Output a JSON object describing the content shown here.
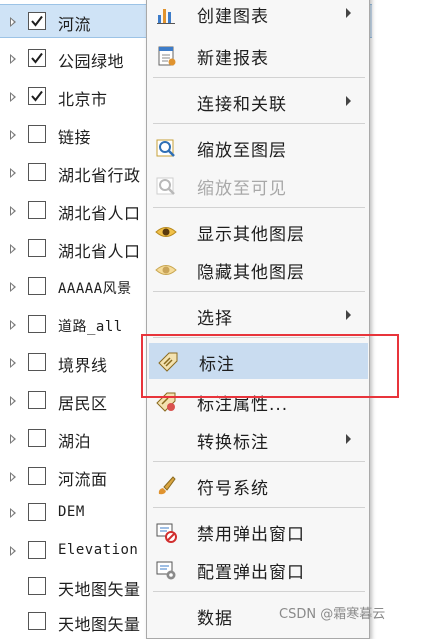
{
  "layers": [
    {
      "name": "河流",
      "checked": true,
      "selected": true,
      "expandable": true
    },
    {
      "name": "公园绿地",
      "checked": true,
      "selected": false,
      "expandable": true
    },
    {
      "name": "北京市",
      "checked": true,
      "selected": false,
      "expandable": true
    },
    {
      "name": "链接",
      "checked": false,
      "selected": false,
      "expandable": true
    },
    {
      "name": "湖北省行政",
      "checked": false,
      "selected": false,
      "expandable": true
    },
    {
      "name": "湖北省人口",
      "checked": false,
      "selected": false,
      "expandable": true
    },
    {
      "name": "湖北省人口",
      "checked": false,
      "selected": false,
      "expandable": true
    },
    {
      "name": "AAAAA风景",
      "checked": false,
      "selected": false,
      "expandable": true
    },
    {
      "name": "道路_all",
      "checked": false,
      "selected": false,
      "expandable": true
    },
    {
      "name": "境界线",
      "checked": false,
      "selected": false,
      "expandable": true
    },
    {
      "name": "居民区",
      "checked": false,
      "selected": false,
      "expandable": true
    },
    {
      "name": "湖泊",
      "checked": false,
      "selected": false,
      "expandable": true
    },
    {
      "name": "河流面",
      "checked": false,
      "selected": false,
      "expandable": true
    },
    {
      "name": "DEM",
      "checked": false,
      "selected": false,
      "expandable": true
    },
    {
      "name": "Elevation",
      "checked": false,
      "selected": false,
      "expandable": true
    },
    {
      "name": "天地图矢量",
      "checked": false,
      "selected": false,
      "expandable": false
    },
    {
      "name": "天地图矢量",
      "checked": false,
      "selected": false,
      "expandable": false
    }
  ],
  "menu": {
    "create_chart": "创建图表",
    "new_report": "新建报表",
    "joins_relates": "连接和关联",
    "zoom_to_layer": "缩放至图层",
    "zoom_to_visible": "缩放至可见",
    "show_other_layers": "显示其他图层",
    "hide_other_layers": "隐藏其他图层",
    "selection": "选择",
    "label": "标注",
    "label_properties": "标注属性...",
    "convert_labels": "转换标注",
    "symbology": "符号系统",
    "disable_popups": "禁用弹出窗口",
    "configure_popups": "配置弹出窗口",
    "data": "数据"
  },
  "colors": {
    "selection": "#cfe3f6",
    "highlight": "#c9dcf0",
    "annotation": "#e8343b"
  },
  "watermark": "CSDN @霜寒暮云"
}
